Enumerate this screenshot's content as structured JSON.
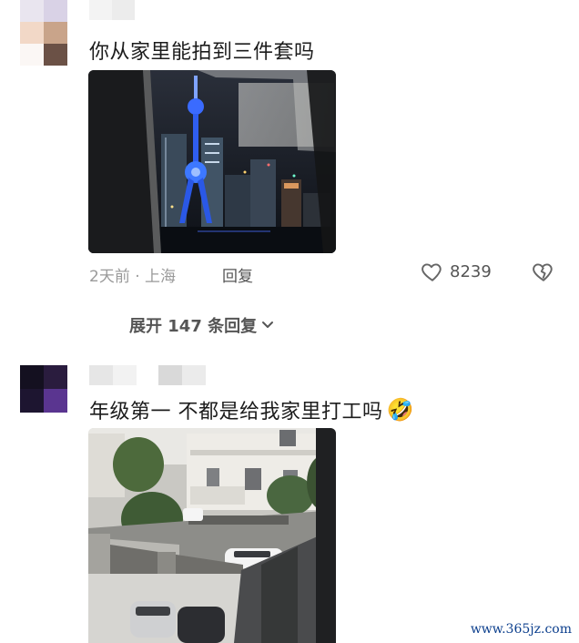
{
  "comments": [
    {
      "text": "你从家里能拍到三件套吗",
      "time_location": "2天前 · 上海",
      "reply_label": "回复",
      "likes": "8239",
      "like_icon": "heart-outline-icon",
      "dislike_icon": "broken-heart-icon",
      "expand_label": "展开 147 条回复"
    },
    {
      "text": "年级第一 不都是给我家里打工吗",
      "emoji": "🤣"
    }
  ],
  "watermark": "www.365jz.com",
  "colors": {
    "meta_gray": "#9a9a9a",
    "text": "#1c1c1c",
    "tower_blue": "#2f6bff"
  }
}
